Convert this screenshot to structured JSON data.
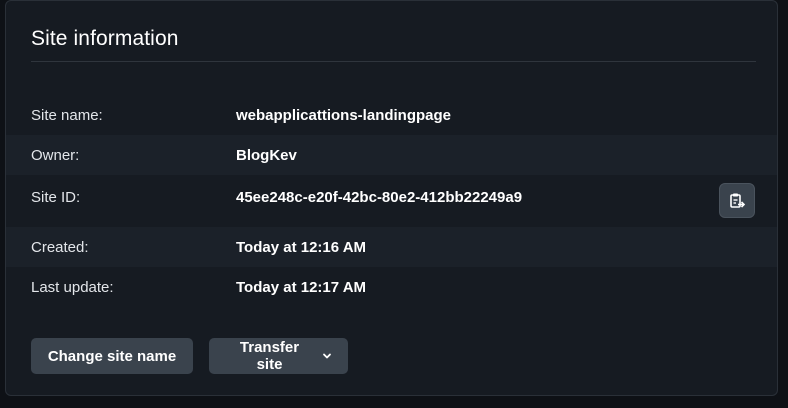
{
  "panel": {
    "title": "Site information"
  },
  "rows": [
    {
      "label": "Site name:",
      "value": "webapplicattions-landingpage"
    },
    {
      "label": "Owner:",
      "value": "BlogKev"
    },
    {
      "label": "Site ID:",
      "value": "45ee248c-e20f-42bc-80e2-412bb22249a9",
      "action_icon": "copy-to-clipboard-icon"
    },
    {
      "label": "Created:",
      "value": "Today at 12:16 AM"
    },
    {
      "label": "Last update:",
      "value": "Today at 12:17 AM"
    }
  ],
  "actions": {
    "change_name_label": "Change site name",
    "transfer_label": "Transfer site",
    "transfer_icon": "chevron-down-icon"
  },
  "colors": {
    "background": "#0e1116",
    "panel": "#161b22",
    "row_alt": "#1b2129",
    "button": "#3a434d",
    "text": "#ffffff"
  }
}
